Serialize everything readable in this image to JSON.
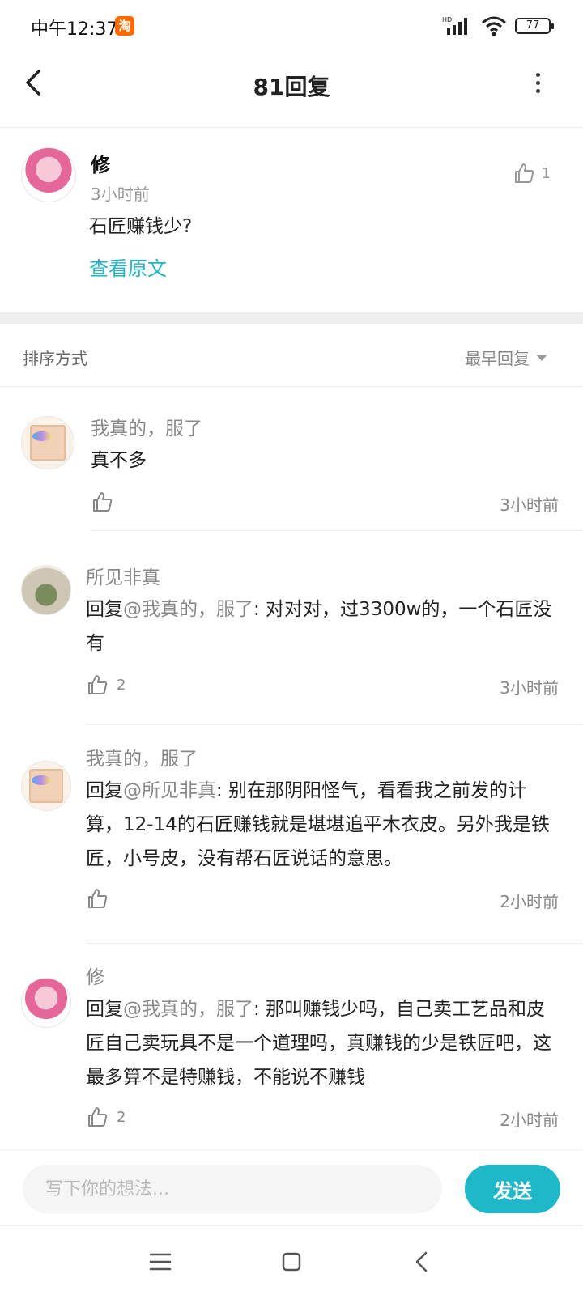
{
  "status_bar": {
    "time": "中午12:37",
    "app_badge": "淘",
    "network": "HD",
    "battery": "77"
  },
  "header": {
    "title": "81回复"
  },
  "post": {
    "author": "修",
    "time": "3小时前",
    "content": "石匠赚钱少?",
    "view_original": "查看原文",
    "like_count": "1"
  },
  "sort": {
    "label": "排序方式",
    "selected": "最早回复"
  },
  "replies": [
    {
      "author": "我真的，服了",
      "prefix": "",
      "mention": "",
      "text": "真不多",
      "like_count": "",
      "time": "3小时前"
    },
    {
      "author": "所见非真",
      "prefix": "回复",
      "mention": "@我真的，服了",
      "text": ": 对对对，过3300w的，一个石匠没有",
      "like_count": "2",
      "time": "3小时前"
    },
    {
      "author": "我真的，服了",
      "prefix": "回复",
      "mention": "@所见非真",
      "text": ": 别在那阴阳怪气，看看我之前发的计算，12-14的石匠赚钱就是堪堪追平木衣皮。另外我是铁匠，小号皮，没有帮石匠说话的意思。",
      "like_count": "",
      "time": "2小时前"
    },
    {
      "author": "修",
      "prefix": "回复",
      "mention": "@我真的，服了",
      "text": ": 那叫赚钱少吗，自己卖工艺品和皮匠自己卖玩具不是一个道理吗，真赚钱的少是铁匠吧，这最多算不是特赚钱，不能说不赚钱",
      "like_count": "2",
      "time": "2小时前"
    }
  ],
  "input": {
    "placeholder": "写下你的想法...",
    "send_label": "发送"
  },
  "colors": {
    "accent": "#1fb8c8",
    "link": "#22b4c4"
  }
}
